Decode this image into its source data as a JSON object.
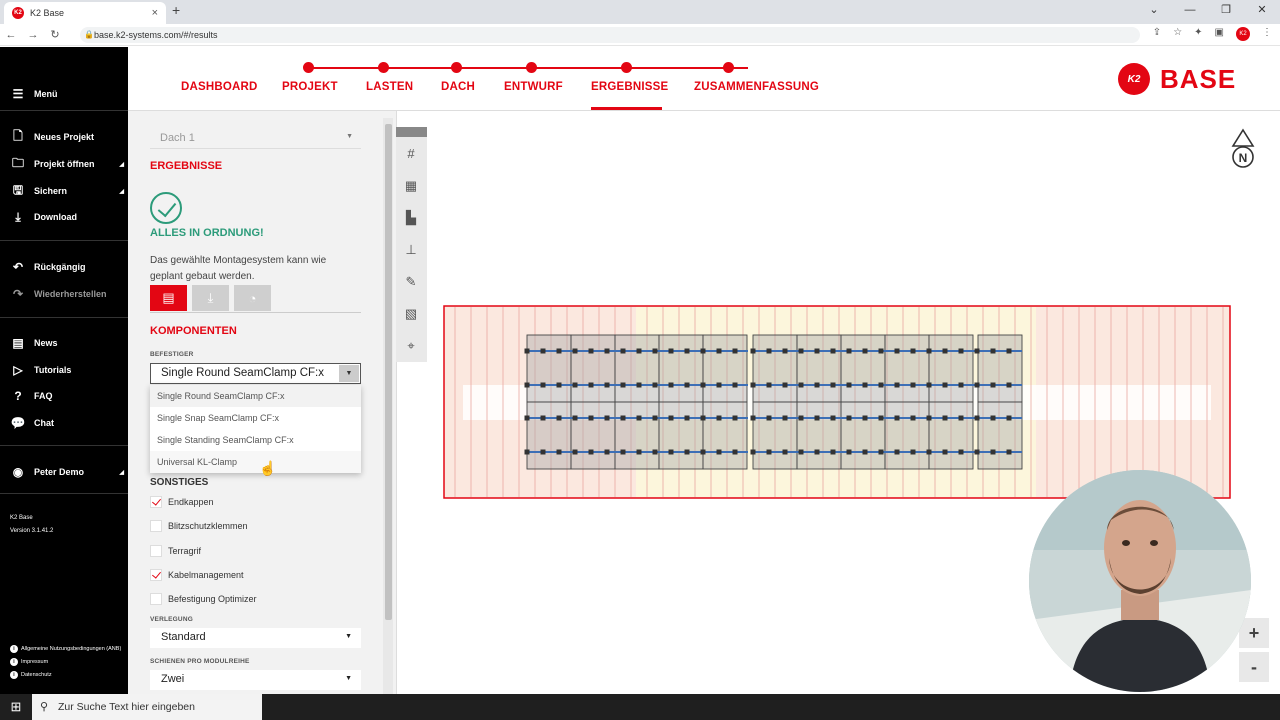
{
  "browser": {
    "tab_title": "K2 Base",
    "tab_favicon": "K2",
    "url": "base.k2-systems.com/#/results"
  },
  "sidebar": {
    "menu_label": "Menü",
    "items": [
      {
        "label": "Neues Projekt",
        "icon": "new-project-icon"
      },
      {
        "label": "Projekt öffnen",
        "icon": "folder-icon"
      },
      {
        "label": "Sichern",
        "icon": "save-icon"
      },
      {
        "label": "Download",
        "icon": "download-icon"
      },
      {
        "label": "Rückgängig",
        "icon": "undo-icon"
      },
      {
        "label": "Wiederherstellen",
        "icon": "redo-icon"
      },
      {
        "label": "News",
        "icon": "news-icon"
      },
      {
        "label": "Tutorials",
        "icon": "tutorials-icon"
      },
      {
        "label": "FAQ",
        "icon": "faq-icon"
      },
      {
        "label": "Chat",
        "icon": "chat-icon"
      },
      {
        "label": "Peter Demo",
        "icon": "user-icon"
      }
    ],
    "app_name": "K2 Base",
    "version": "Version 3.1.41.2",
    "footer": [
      "Allgemeine Nutzungsbedingungen (ANB)",
      "Impressum",
      "Datenschutz"
    ]
  },
  "nav": {
    "steps": [
      "DASHBOARD",
      "PROJEKT",
      "LASTEN",
      "DACH",
      "ENTWURF",
      "ERGEBNISSE",
      "ZUSAMMENFASSUNG"
    ],
    "active": "ERGEBNISSE",
    "brand": "BASE",
    "logo_text": "K2"
  },
  "panel": {
    "roof_select": "Dach 1",
    "results_heading": "ERGEBNISSE",
    "ok_title": "ALLES IN ORDNUNG!",
    "ok_desc": "Das gewählte Montagesystem kann wie geplant gebaut werden.",
    "components_heading": "KOMPONENTEN",
    "fastener_label": "BEFESTIGER",
    "fastener_value": "Single Round SeamClamp CF:x",
    "fastener_options": [
      "Single Round SeamClamp CF:x",
      "Single Snap SeamClamp CF:x",
      "Single Standing SeamClamp CF:x",
      "Universal KL-Clamp"
    ],
    "misc_heading": "SONSTIGES",
    "checkboxes": [
      {
        "label": "Endkappen",
        "checked": true
      },
      {
        "label": "Blitzschutzklemmen",
        "checked": false
      },
      {
        "label": "Terragrif",
        "checked": false
      },
      {
        "label": "Kabelmanagement",
        "checked": true
      },
      {
        "label": "Befestigung Optimizer",
        "checked": false
      }
    ],
    "laying_label": "VERLEGUNG",
    "laying_value": "Standard",
    "rails_label": "SCHIENEN PRO MODULREIHE",
    "rails_value": "Zwei"
  },
  "canvas": {
    "compass": "N",
    "zoom_in": "+",
    "zoom_out": "-"
  },
  "taskbar": {
    "search_placeholder": "Zur Suche Text hier eingeben"
  },
  "colors": {
    "accent": "#e30613",
    "ok": "#2c9b7a"
  }
}
